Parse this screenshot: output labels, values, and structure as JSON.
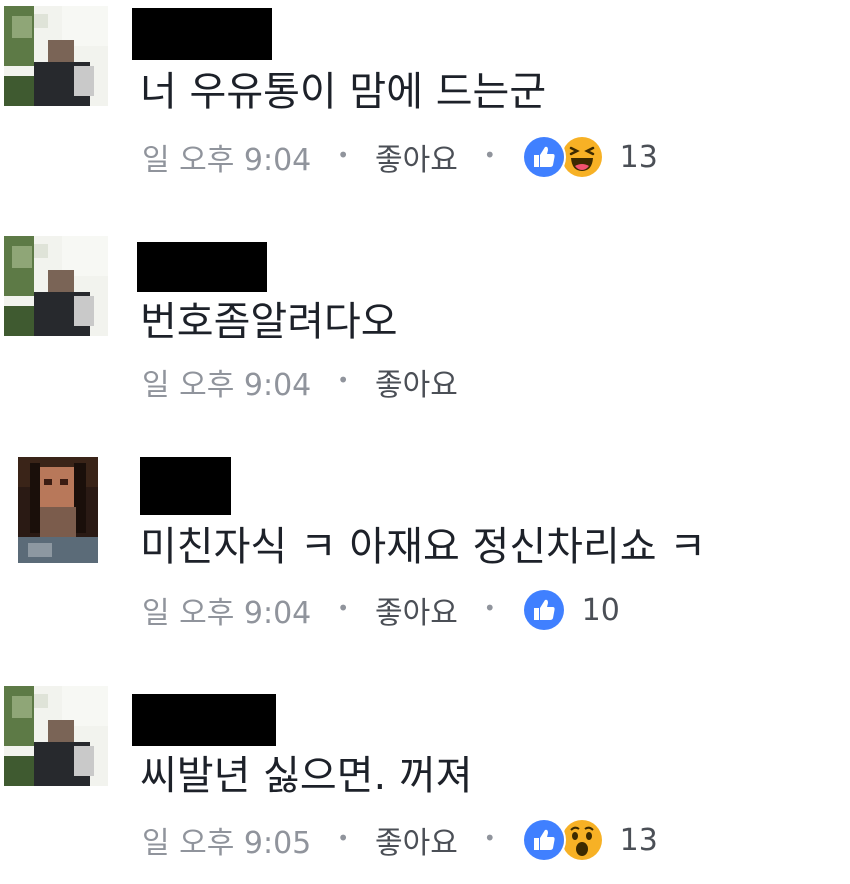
{
  "colors": {
    "comment_text": "#1d2129",
    "meta_text": "#90949c",
    "like_blue": "#4080ff",
    "emoji_yellow": "#f7b125"
  },
  "comments": [
    {
      "text": "너 우유통이 맘에 드는군",
      "time": "일 오후 9:04",
      "like_label": "좋아요",
      "separator": "•",
      "reactions": [
        "like-icon",
        "haha-icon"
      ],
      "reaction_count": "13"
    },
    {
      "text": "번호좀알려다오",
      "time": "일 오후 9:04",
      "like_label": "좋아요",
      "separator": "•"
    },
    {
      "text": "미친자식 ㅋ 아재요 정신차리쇼 ㅋ",
      "time": "일 오후 9:04",
      "like_label": "좋아요",
      "separator": "•",
      "reactions": [
        "like-icon"
      ],
      "reaction_count": "10"
    },
    {
      "text": "씨발년 싫으면. 꺼져",
      "time": "일 오후 9:05",
      "like_label": "좋아요",
      "separator": "•",
      "reactions": [
        "like-icon",
        "wow-icon"
      ],
      "reaction_count": "13"
    }
  ]
}
